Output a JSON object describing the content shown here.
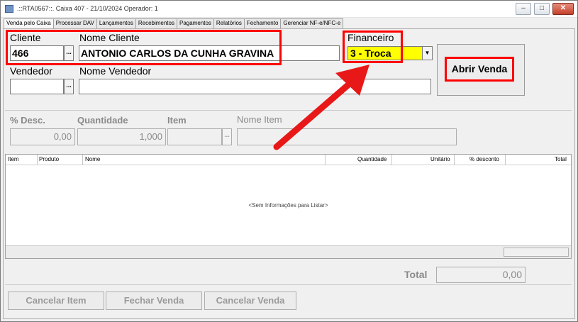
{
  "window": {
    "title": ".::RTA0567::. Caixa 407 - 21/10/2024 Operador: 1",
    "minimize": "–",
    "maximize": "□",
    "close": "✕"
  },
  "tabs": [
    "Venda pelo Caixa",
    "Processar DAV",
    "Lançamentos",
    "Recebimentos",
    "Pagamentos",
    "Relatórios",
    "Fechamento",
    "Gerenciar NF-e/NFC-e"
  ],
  "cliente": {
    "label": "Cliente",
    "code": "466",
    "button": "..."
  },
  "nome_cliente": {
    "label": "Nome Cliente",
    "value": "ANTONIO CARLOS DA CUNHA GRAVINA"
  },
  "financeiro": {
    "label": "Financeiro",
    "value": "3 - Troca",
    "arrow": "▼"
  },
  "abrir_venda": {
    "label": "Abrir Venda"
  },
  "vendedor": {
    "label": "Vendedor",
    "value": "",
    "button": "..."
  },
  "nome_vendedor": {
    "label": "Nome Vendedor",
    "value": ""
  },
  "desc": {
    "label": "% Desc.",
    "value": "0,00"
  },
  "quantidade": {
    "label": "Quantidade",
    "value": "1,000"
  },
  "item": {
    "label": "Item",
    "value": "",
    "button": "..."
  },
  "nome_item": {
    "label": "Nome Item",
    "value": ""
  },
  "grid": {
    "columns": [
      "Item",
      "Produto",
      "Nome",
      "Quantidade",
      "Unitário",
      "% desconto",
      "Total"
    ],
    "empty_message": "<Sem Informações para Listar>"
  },
  "total": {
    "label": "Total",
    "value": "0,00"
  },
  "buttons": {
    "cancelar_item": "Cancelar Item",
    "fechar_venda": "Fechar Venda",
    "cancelar_venda": "Cancelar Venda"
  },
  "colors": {
    "highlight": "#ff0000",
    "financeiro_bg": "#ffff00",
    "arrow": "#e81818"
  }
}
